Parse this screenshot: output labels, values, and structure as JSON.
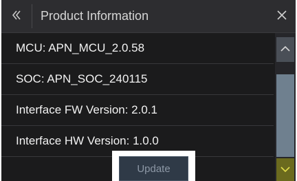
{
  "header": {
    "title": "Product Information",
    "back_icon": "double-chevron-left-icon",
    "close_icon": "close-icon"
  },
  "info_rows": [
    {
      "label": "MCU: APN_MCU_2.0.58"
    },
    {
      "label": "SOC: APN_SOC_240115"
    },
    {
      "label": "Interface FW Version: 2.0.1"
    },
    {
      "label": "Interface HW Version: 1.0.0"
    }
  ],
  "actions": {
    "update_label": "Update"
  },
  "scrollbar": {
    "up_icon": "chevron-up-icon",
    "down_icon": "chevron-down-icon"
  },
  "colors": {
    "background": "#1b1b1c",
    "titlebar": "#2d2d30",
    "text": "#f2f2f2",
    "scroll_thumb": "#6f808f",
    "scroll_down_accent": "#6b6a1e",
    "update_button": "#2f3a47"
  }
}
